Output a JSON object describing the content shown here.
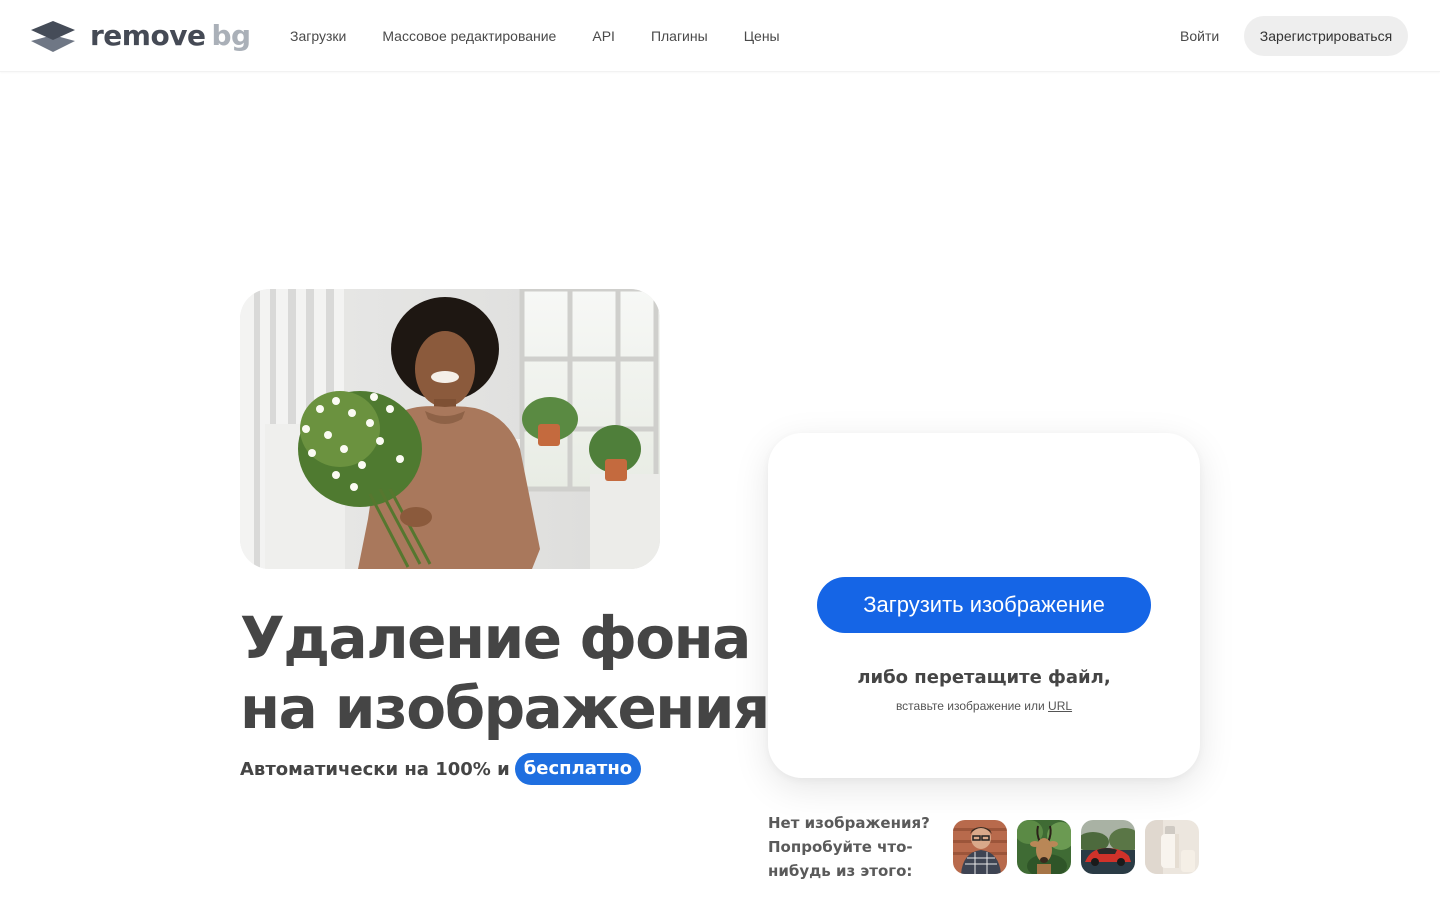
{
  "brand": {
    "word1": "remove",
    "word2": "bg"
  },
  "nav": {
    "items": [
      {
        "label": "Загрузки"
      },
      {
        "label": "Массовое редактирование"
      },
      {
        "label": "API"
      },
      {
        "label": "Плагины"
      },
      {
        "label": "Цены"
      }
    ],
    "login": "Войти",
    "signup": "Зарегистрироваться"
  },
  "hero": {
    "title_line1": "Удаление фона",
    "title_line2": "на изображениях",
    "subtitle": "Автоматически на 100% и",
    "badge": "бесплатно"
  },
  "upload": {
    "button": "Загрузить изображение",
    "drop_text": "либо перетащите файл,",
    "paste_text": "вставьте изображение или",
    "url_link": "URL"
  },
  "samples": {
    "label": "Нет изображения? Попробуйте что-нибудь из этого:",
    "items": [
      "person-sample",
      "antelope-sample",
      "car-sample",
      "bottle-sample"
    ]
  },
  "colors": {
    "primary": "#1565e6",
    "badge": "#1f6fe0",
    "text": "#454545",
    "signup_bg": "#eeeeee"
  }
}
